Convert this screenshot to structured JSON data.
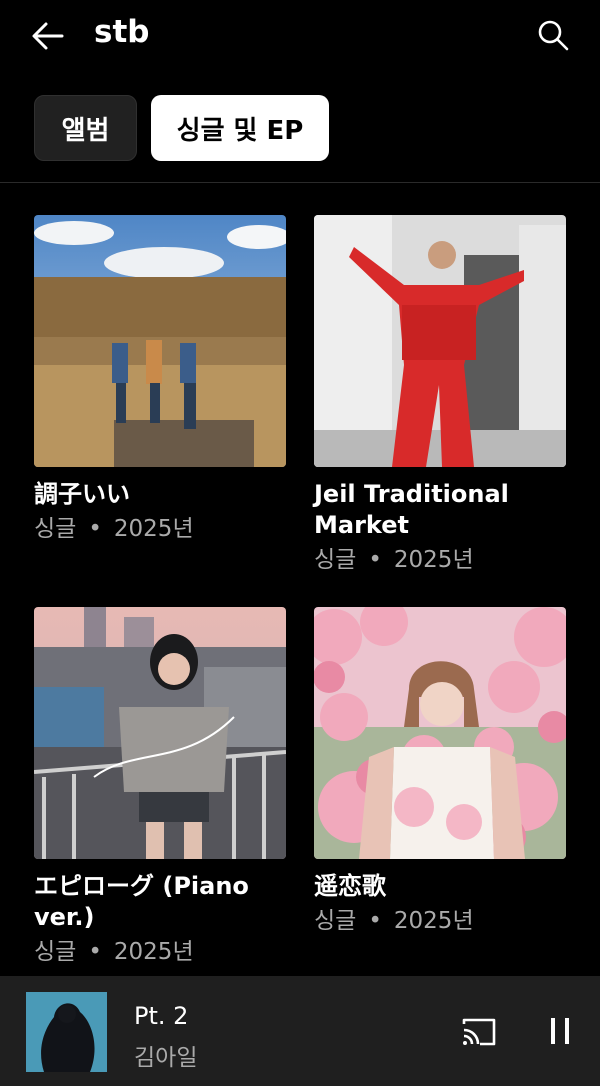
{
  "header": {
    "title": "stb"
  },
  "tabs": [
    {
      "label": "앨범",
      "selected": false
    },
    {
      "label": "싱글 및 EP",
      "selected": true
    }
  ],
  "releases": [
    {
      "title": "調子いい",
      "type": "싱글",
      "dot": "•",
      "year": "2025년"
    },
    {
      "title": "Jeil Traditional Market",
      "type": "싱글",
      "dot": "•",
      "year": "2025년"
    },
    {
      "title": "エピローグ (Piano ver.)",
      "type": "싱글",
      "dot": "•",
      "year": "2025년"
    },
    {
      "title": "遥恋歌",
      "type": "싱글",
      "dot": "•",
      "year": "2025년"
    }
  ],
  "player": {
    "title": "Pt. 2",
    "artist": "김아일"
  },
  "icons": [
    "back-arrow-icon",
    "search-icon",
    "cast-icon",
    "pause-icon"
  ],
  "colors": {
    "background": "#000000",
    "chip_selected": "#ffffff",
    "chip_unselected": "#212121",
    "player_bg": "#1f1f1f",
    "meta_text": "#aaaaaa"
  }
}
